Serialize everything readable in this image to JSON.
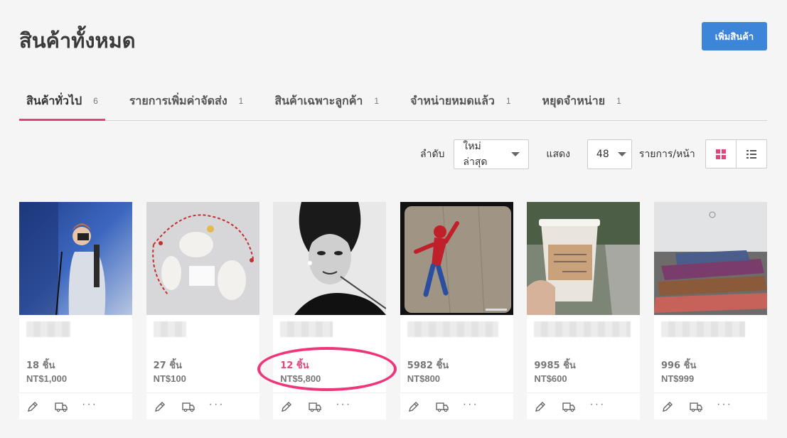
{
  "header": {
    "title": "สินค้าทั้งหมด",
    "add_button": "เพิ่มสินค้า"
  },
  "tabs": [
    {
      "label": "สินค้าทั่วไป",
      "count": "6"
    },
    {
      "label": "รายการเพิ่มค่าจัดส่ง",
      "count": "1"
    },
    {
      "label": "สินค้าเฉพาะลูกค้า",
      "count": "1"
    },
    {
      "label": "จำหน่ายหมดแล้ว",
      "count": "1"
    },
    {
      "label": "หยุดจำหน่าย",
      "count": "1"
    }
  ],
  "toolbar": {
    "sort_label": "ลำดับ",
    "sort_value": "ใหม่ล่าสุด",
    "show_label": "แสดง",
    "per_page_value": "48",
    "per_page_suffix": "รายการ/หน้า"
  },
  "view": {
    "active": "grid",
    "active_color": "#e0457b"
  },
  "products": [
    {
      "image": "photographer",
      "quantity": "18 ชิ้น",
      "price": "NT$1,000",
      "low_stock": false
    },
    {
      "image": "paper-craft",
      "quantity": "27 ชิ้น",
      "price": "NT$100",
      "low_stock": false
    },
    {
      "image": "portrait-bw",
      "quantity": "12 ชิ้น",
      "price": "NT$5,800",
      "low_stock": true
    },
    {
      "image": "spiderman-wall",
      "quantity": "5982 ชิ้น",
      "price": "NT$800",
      "low_stock": false
    },
    {
      "image": "coffee-cup",
      "quantity": "9985 ชิ้น",
      "price": "NT$600",
      "low_stock": false
    },
    {
      "image": "sleeping-bags",
      "quantity": "996 ชิ้น",
      "price": "NT$999",
      "low_stock": false
    }
  ],
  "card_actions": [
    "edit-icon",
    "shipping-icon",
    "more-icon"
  ],
  "accent_color": "#3d85d8",
  "highlight_color": "#f0367a"
}
